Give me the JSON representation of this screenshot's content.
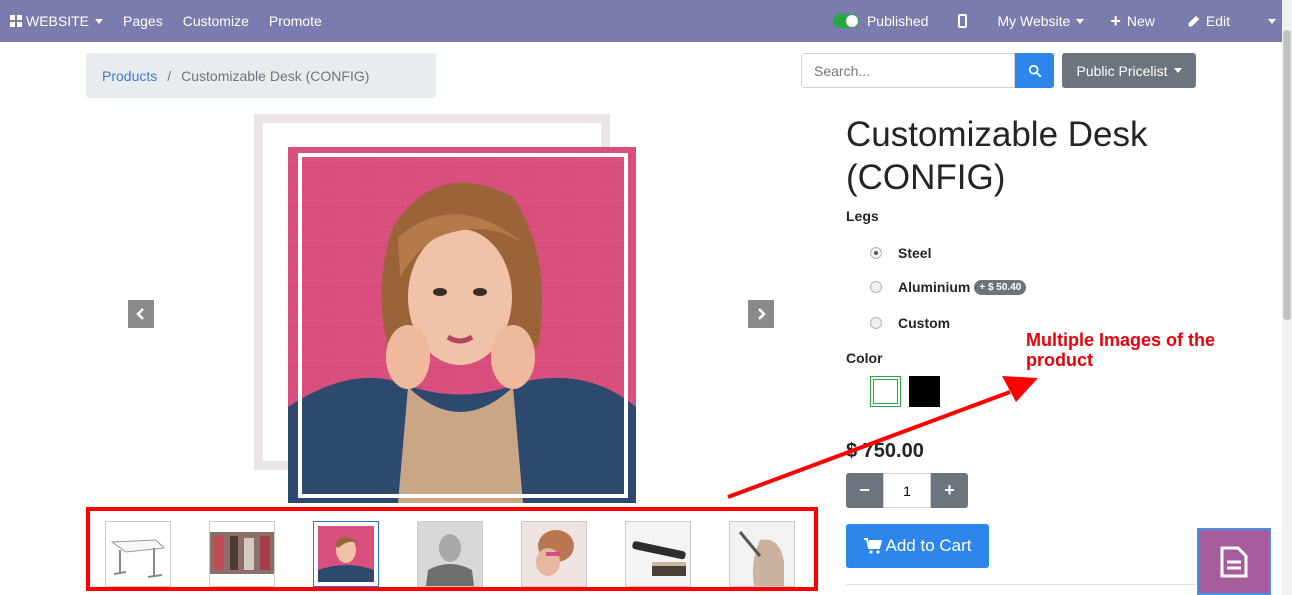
{
  "navbar": {
    "website_label": "WEBSITE",
    "menu": [
      "Pages",
      "Customize",
      "Promote"
    ],
    "published_label": "Published",
    "my_website_label": "My Website",
    "new_label": "New",
    "edit_label": "Edit",
    "background_color": "#7c7bad"
  },
  "breadcrumb": {
    "parent": "Products",
    "separator": "/",
    "current": "Customizable Desk (CONFIG)"
  },
  "search": {
    "placeholder": "Search...",
    "value": ""
  },
  "pricelist": {
    "label": "Public Pricelist"
  },
  "product": {
    "title": "Customizable Desk (CONFIG)",
    "legs_label": "Legs",
    "legs_options": [
      {
        "label": "Steel",
        "checked": true,
        "extra": ""
      },
      {
        "label": "Aluminium",
        "checked": false,
        "extra": "+ $ 50.40"
      },
      {
        "label": "Custom",
        "checked": false,
        "extra": ""
      }
    ],
    "color_label": "Color",
    "colors": [
      {
        "name": "white",
        "hex": "#ffffff",
        "selected": true
      },
      {
        "name": "black",
        "hex": "#000000",
        "selected": false
      }
    ],
    "price": "$ 750.00",
    "quantity": "1",
    "add_to_cart_label": "Add to Cart"
  },
  "gallery": {
    "thumbnail_count": 7,
    "active_index": 2,
    "thumbnails": [
      "desk",
      "shop-photo",
      "woman-pink-wall",
      "man-portrait",
      "woman-hairstyle",
      "hair-straightener",
      "woman-hair-tool"
    ]
  },
  "annotation": {
    "text": "Multiple Images of the product",
    "color": "#e8000b"
  },
  "colors": {
    "accent": "#2e86ec",
    "secondary": "#6c757d",
    "highlight_box": "#ff0000"
  }
}
